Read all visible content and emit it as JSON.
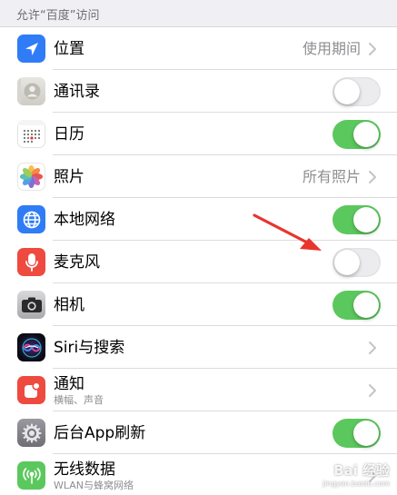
{
  "section_header": "允许“百度”访问",
  "colors": {
    "toggle_on": "#5bc85d",
    "toggle_off": "#e9e9eb",
    "location_icon_bg": "#2f7cf6",
    "microphone_icon_bg": "#ee4a3f",
    "notifications_icon_bg": "#ee4a3f",
    "network_icon_bg": "#2f7cf6",
    "cellular_icon_bg": "#5bc85d",
    "arrow": "#e8352e"
  },
  "rows": [
    {
      "label": "位置",
      "value": "使用期间",
      "icon": "location-arrow-icon"
    },
    {
      "label": "通讯录",
      "toggle": false,
      "icon": "contacts-icon"
    },
    {
      "label": "日历",
      "toggle": true,
      "icon": "calendar-icon"
    },
    {
      "label": "照片",
      "value": "所有照片",
      "icon": "photos-icon"
    },
    {
      "label": "本地网络",
      "toggle": true,
      "icon": "globe-icon"
    },
    {
      "label": "麦克风",
      "toggle": false,
      "icon": "microphone-icon"
    },
    {
      "label": "相机",
      "toggle": true,
      "icon": "camera-icon"
    },
    {
      "label": "Siri与搜索",
      "icon": "siri-icon"
    },
    {
      "label": "通知",
      "sublabel": "横幅、声音",
      "icon": "notifications-icon"
    },
    {
      "label": "后台App刷新",
      "toggle": true,
      "icon": "gear-icon"
    },
    {
      "label": "无线数据",
      "sublabel": "WLAN与蜂窝网络",
      "icon": "cellular-antenna-icon"
    }
  ],
  "watermark": {
    "text": "Bai 经验",
    "url": "jingyan.baidu.com"
  }
}
